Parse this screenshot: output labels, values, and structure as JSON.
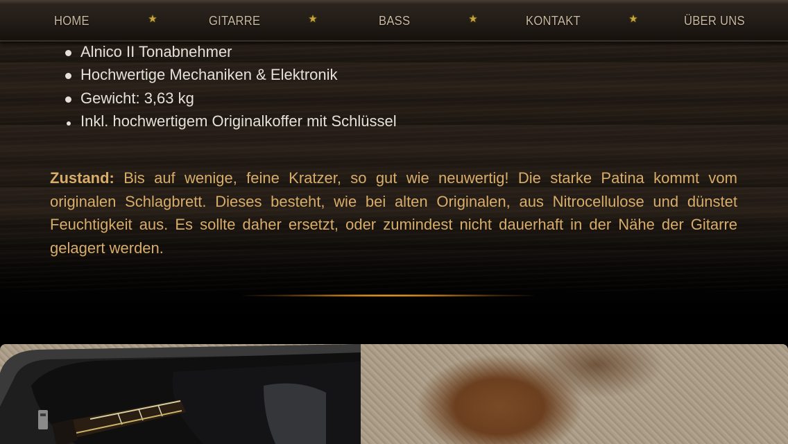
{
  "nav": {
    "items": [
      {
        "label": "HOME"
      },
      {
        "label": "GITARRE"
      },
      {
        "label": "BASS"
      },
      {
        "label": "KONTAKT"
      },
      {
        "label": "ÜBER UNS"
      }
    ],
    "separator_icon": "star-icon",
    "separator_color": "#c8a73a"
  },
  "features": [
    "Alnico II Tonabnehmer",
    "Hochwertige Mechaniken & Elektronik",
    "Gewicht: 3,63 kg",
    "Inkl. hochwertigem Originalkoffer mit Schlüssel"
  ],
  "condition": {
    "label": "Zustand:",
    "text": " Bis auf wenige, feine Kratzer, so gut wie neuwertig! Die starke Patina kommt vom originalen Schlagbrett. Dieses besteht, wie bei alten Originalen, aus Nitrocellulose und dünstet Feuchtigkeit aus. Es sollte daher ersetzt, oder zumindest nicht dauerhaft in der Nähe der Gitarre gelagert werden."
  },
  "colors": {
    "text_primary": "#e6e1d8",
    "text_accent": "#d8ad6a",
    "divider_glow": "#f2b54a"
  }
}
